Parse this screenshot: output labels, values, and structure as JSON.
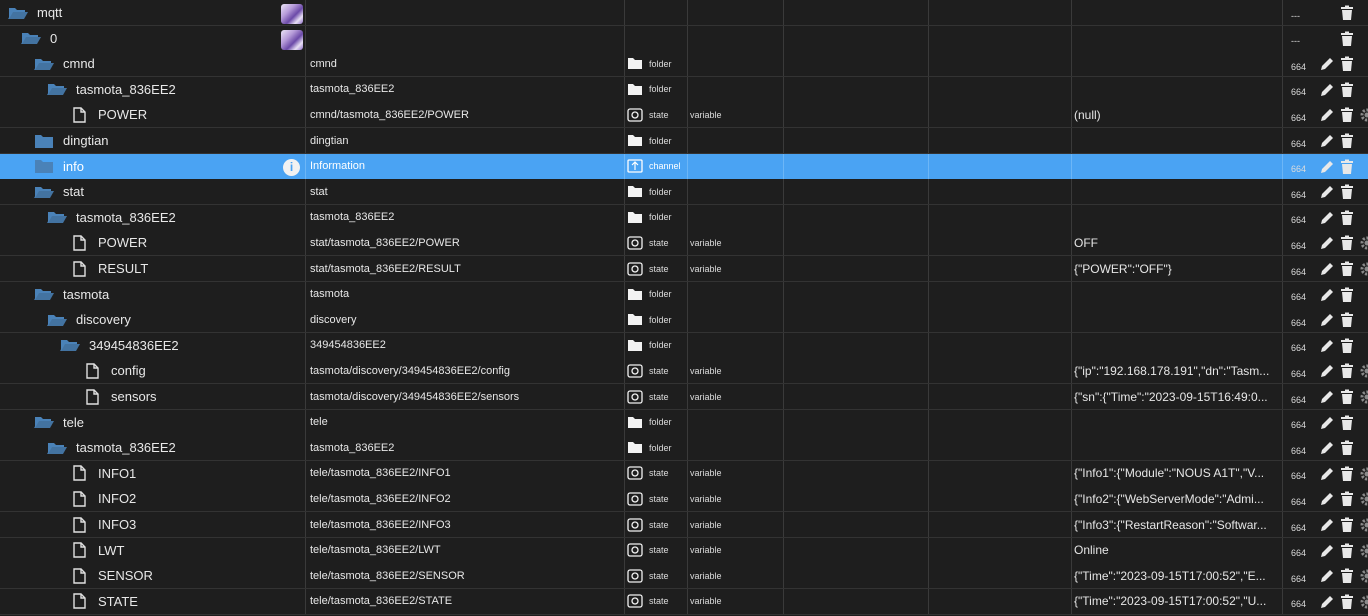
{
  "colors": {
    "background": "#1e1e1e",
    "selected_row": "#4aa3f3",
    "folder_icon": "#4a82b8",
    "text": "#e6e6e6"
  },
  "rows": [
    {
      "depth": 0,
      "kind": "folder-open",
      "name": "mqtt",
      "nickname": "",
      "type_icon": "",
      "type": "",
      "role": "",
      "value": "",
      "acl": "---",
      "has_pic": true,
      "selected": false,
      "edit": false,
      "gear": false
    },
    {
      "depth": 1,
      "kind": "folder-open",
      "name": "0",
      "nickname": "",
      "type_icon": "",
      "type": "",
      "role": "",
      "value": "",
      "acl": "---",
      "has_pic": true,
      "selected": false,
      "edit": false,
      "gear": false
    },
    {
      "depth": 2,
      "kind": "folder-open",
      "name": "cmnd",
      "nickname": "cmnd",
      "type_icon": "folder-icon",
      "type": "folder",
      "role": "",
      "value": "",
      "acl": "664",
      "has_pic": false,
      "selected": false,
      "edit": true,
      "gear": false
    },
    {
      "depth": 3,
      "kind": "folder-open",
      "name": "tasmota_836EE2",
      "nickname": "tasmota_836EE2",
      "type_icon": "folder-icon",
      "type": "folder",
      "role": "",
      "value": "",
      "acl": "664",
      "has_pic": false,
      "selected": false,
      "edit": true,
      "gear": false
    },
    {
      "depth": 4,
      "kind": "file",
      "name": "POWER",
      "nickname": "cmnd/tasmota_836EE2/POWER",
      "type_icon": "state-icon",
      "type": "state",
      "role": "variable",
      "value": "(null)",
      "acl": "664",
      "has_pic": false,
      "selected": false,
      "edit": true,
      "gear": true
    },
    {
      "depth": 2,
      "kind": "folder-closed",
      "name": "dingtian",
      "nickname": "dingtian",
      "type_icon": "folder-icon",
      "type": "folder",
      "role": "",
      "value": "",
      "acl": "664",
      "has_pic": false,
      "selected": false,
      "edit": true,
      "gear": false
    },
    {
      "depth": 2,
      "kind": "folder-closed",
      "name": "info",
      "nickname": "Information",
      "type_icon": "channel-icon",
      "type": "channel",
      "role": "",
      "value": "",
      "acl": "664",
      "has_pic": false,
      "info_badge": true,
      "selected": true,
      "edit": true,
      "gear": false
    },
    {
      "depth": 2,
      "kind": "folder-open",
      "name": "stat",
      "nickname": "stat",
      "type_icon": "folder-icon",
      "type": "folder",
      "role": "",
      "value": "",
      "acl": "664",
      "has_pic": false,
      "selected": false,
      "edit": true,
      "gear": false
    },
    {
      "depth": 3,
      "kind": "folder-open",
      "name": "tasmota_836EE2",
      "nickname": "tasmota_836EE2",
      "type_icon": "folder-icon",
      "type": "folder",
      "role": "",
      "value": "",
      "acl": "664",
      "has_pic": false,
      "selected": false,
      "edit": true,
      "gear": false
    },
    {
      "depth": 4,
      "kind": "file",
      "name": "POWER",
      "nickname": "stat/tasmota_836EE2/POWER",
      "type_icon": "state-icon",
      "type": "state",
      "role": "variable",
      "value": "OFF",
      "acl": "664",
      "has_pic": false,
      "selected": false,
      "edit": true,
      "gear": true
    },
    {
      "depth": 4,
      "kind": "file",
      "name": "RESULT",
      "nickname": "stat/tasmota_836EE2/RESULT",
      "type_icon": "state-icon",
      "type": "state",
      "role": "variable",
      "value": "{\"POWER\":\"OFF\"}",
      "acl": "664",
      "has_pic": false,
      "selected": false,
      "edit": true,
      "gear": true
    },
    {
      "depth": 2,
      "kind": "folder-open",
      "name": "tasmota",
      "nickname": "tasmota",
      "type_icon": "folder-icon",
      "type": "folder",
      "role": "",
      "value": "",
      "acl": "664",
      "has_pic": false,
      "selected": false,
      "edit": true,
      "gear": false
    },
    {
      "depth": 3,
      "kind": "folder-open",
      "name": "discovery",
      "nickname": "discovery",
      "type_icon": "folder-icon",
      "type": "folder",
      "role": "",
      "value": "",
      "acl": "664",
      "has_pic": false,
      "selected": false,
      "edit": true,
      "gear": false
    },
    {
      "depth": 4,
      "kind": "folder-open",
      "name": "349454836EE2",
      "nickname": "349454836EE2",
      "type_icon": "folder-icon",
      "type": "folder",
      "role": "",
      "value": "",
      "acl": "664",
      "has_pic": false,
      "selected": false,
      "edit": true,
      "gear": false
    },
    {
      "depth": 5,
      "kind": "file",
      "name": "config",
      "nickname": "tasmota/discovery/349454836EE2/config",
      "type_icon": "state-icon",
      "type": "state",
      "role": "variable",
      "value": "{\"ip\":\"192.168.178.191\",\"dn\":\"Tasm...",
      "acl": "664",
      "has_pic": false,
      "selected": false,
      "edit": true,
      "gear": true
    },
    {
      "depth": 5,
      "kind": "file",
      "name": "sensors",
      "nickname": "tasmota/discovery/349454836EE2/sensors",
      "type_icon": "state-icon",
      "type": "state",
      "role": "variable",
      "value": "{\"sn\":{\"Time\":\"2023-09-15T16:49:0...",
      "acl": "664",
      "has_pic": false,
      "selected": false,
      "edit": true,
      "gear": true
    },
    {
      "depth": 2,
      "kind": "folder-open",
      "name": "tele",
      "nickname": "tele",
      "type_icon": "folder-icon",
      "type": "folder",
      "role": "",
      "value": "",
      "acl": "664",
      "has_pic": false,
      "selected": false,
      "edit": true,
      "gear": false
    },
    {
      "depth": 3,
      "kind": "folder-open",
      "name": "tasmota_836EE2",
      "nickname": "tasmota_836EE2",
      "type_icon": "folder-icon",
      "type": "folder",
      "role": "",
      "value": "",
      "acl": "664",
      "has_pic": false,
      "selected": false,
      "edit": true,
      "gear": false
    },
    {
      "depth": 4,
      "kind": "file",
      "name": "INFO1",
      "nickname": "tele/tasmota_836EE2/INFO1",
      "type_icon": "state-icon",
      "type": "state",
      "role": "variable",
      "value": "{\"Info1\":{\"Module\":\"NOUS A1T\",\"V...",
      "acl": "664",
      "has_pic": false,
      "selected": false,
      "edit": true,
      "gear": true
    },
    {
      "depth": 4,
      "kind": "file",
      "name": "INFO2",
      "nickname": "tele/tasmota_836EE2/INFO2",
      "type_icon": "state-icon",
      "type": "state",
      "role": "variable",
      "value": "{\"Info2\":{\"WebServerMode\":\"Admi...",
      "acl": "664",
      "has_pic": false,
      "selected": false,
      "edit": true,
      "gear": true
    },
    {
      "depth": 4,
      "kind": "file",
      "name": "INFO3",
      "nickname": "tele/tasmota_836EE2/INFO3",
      "type_icon": "state-icon",
      "type": "state",
      "role": "variable",
      "value": "{\"Info3\":{\"RestartReason\":\"Softwar...",
      "acl": "664",
      "has_pic": false,
      "selected": false,
      "edit": true,
      "gear": true
    },
    {
      "depth": 4,
      "kind": "file",
      "name": "LWT",
      "nickname": "tele/tasmota_836EE2/LWT",
      "type_icon": "state-icon",
      "type": "state",
      "role": "variable",
      "value": "Online",
      "acl": "664",
      "has_pic": false,
      "selected": false,
      "edit": true,
      "gear": true
    },
    {
      "depth": 4,
      "kind": "file",
      "name": "SENSOR",
      "nickname": "tele/tasmota_836EE2/SENSOR",
      "type_icon": "state-icon",
      "type": "state",
      "role": "variable",
      "value": "{\"Time\":\"2023-09-15T17:00:52\",\"E...",
      "acl": "664",
      "has_pic": false,
      "selected": false,
      "edit": true,
      "gear": true
    },
    {
      "depth": 4,
      "kind": "file",
      "name": "STATE",
      "nickname": "tele/tasmota_836EE2/STATE",
      "type_icon": "state-icon",
      "type": "state",
      "role": "variable",
      "value": "{\"Time\":\"2023-09-15T17:00:52\",\"U...",
      "acl": "664",
      "has_pic": false,
      "selected": false,
      "edit": true,
      "gear": true
    }
  ]
}
